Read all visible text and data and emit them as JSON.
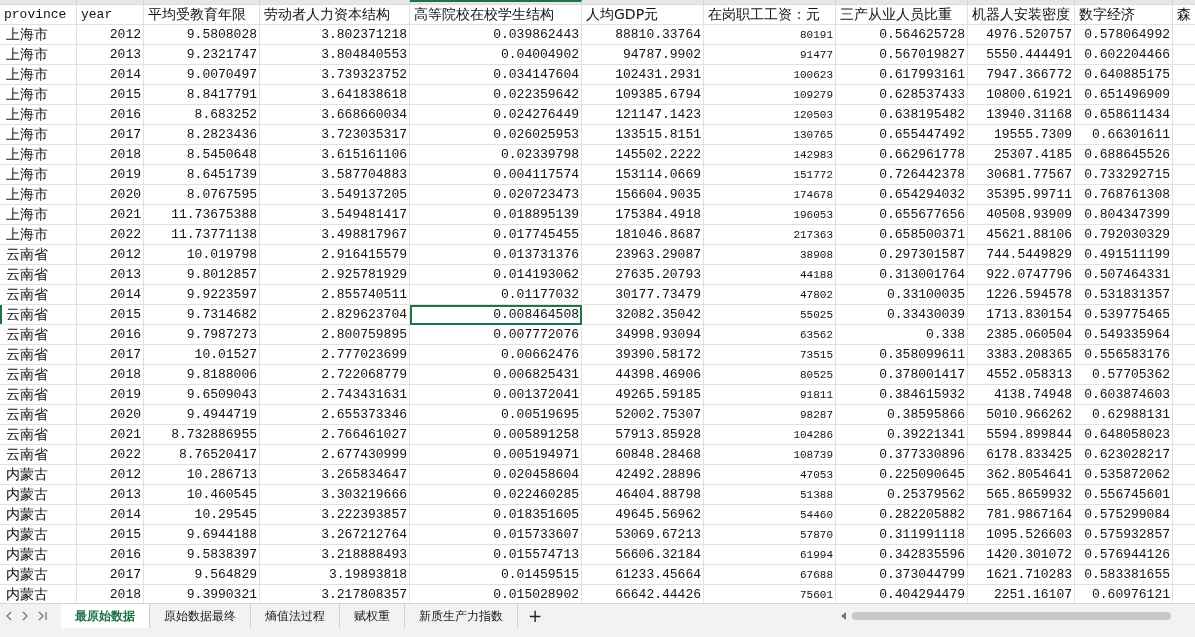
{
  "columns": [
    {
      "label": "province",
      "kind": "text",
      "selected": false
    },
    {
      "label": "year",
      "kind": "number",
      "selected": false
    },
    {
      "label": "平均受教育年限",
      "kind": "number",
      "selected": false
    },
    {
      "label": "劳动者人力资本结构",
      "kind": "number",
      "selected": false
    },
    {
      "label": "高等院校在校学生结构",
      "kind": "number",
      "selected": true
    },
    {
      "label": "人均GDP元",
      "kind": "number",
      "selected": false
    },
    {
      "label": "在岗职工工资：元",
      "kind": "small",
      "selected": false
    },
    {
      "label": "三产从业人员比重",
      "kind": "number",
      "selected": false
    },
    {
      "label": "机器人安装密度",
      "kind": "number",
      "selected": false
    },
    {
      "label": "数字经济",
      "kind": "number",
      "selected": false
    },
    {
      "label": "森",
      "kind": "number",
      "selected": false
    }
  ],
  "rows": [
    {
      "selected": false,
      "cells": [
        "上海市",
        "2012",
        "9.5808028",
        "3.802371218",
        "0.039862443",
        "88810.33764",
        "80191",
        "0.564625728",
        "4976.520757",
        "0.578064992"
      ]
    },
    {
      "selected": false,
      "cells": [
        "上海市",
        "2013",
        "9.2321747",
        "3.804840553",
        "0.04004902",
        "94787.9902",
        "91477",
        "0.567019827",
        "5550.444491",
        "0.602204466"
      ]
    },
    {
      "selected": false,
      "cells": [
        "上海市",
        "2014",
        "9.0070497",
        "3.739323752",
        "0.034147604",
        "102431.2931",
        "100623",
        "0.617993161",
        "7947.366772",
        "0.640885175"
      ]
    },
    {
      "selected": false,
      "cells": [
        "上海市",
        "2015",
        "8.8417791",
        "3.641838618",
        "0.022359642",
        "109385.6794",
        "109279",
        "0.628537433",
        "10800.61921",
        "0.651496909"
      ]
    },
    {
      "selected": false,
      "cells": [
        "上海市",
        "2016",
        "8.683252",
        "3.668660034",
        "0.024276449",
        "121147.1423",
        "120503",
        "0.638195482",
        "13940.31168",
        "0.658611434"
      ]
    },
    {
      "selected": false,
      "cells": [
        "上海市",
        "2017",
        "8.2823436",
        "3.723035317",
        "0.026025953",
        "133515.8151",
        "130765",
        "0.655447492",
        "19555.7309",
        "0.66301611"
      ]
    },
    {
      "selected": false,
      "cells": [
        "上海市",
        "2018",
        "8.5450648",
        "3.615161106",
        "0.02339798",
        "145502.2222",
        "142983",
        "0.662961778",
        "25307.4185",
        "0.688645526"
      ]
    },
    {
      "selected": false,
      "cells": [
        "上海市",
        "2019",
        "8.6451739",
        "3.587704883",
        "0.004117574",
        "153114.0669",
        "151772",
        "0.726442378",
        "30681.77567",
        "0.733292715"
      ]
    },
    {
      "selected": false,
      "cells": [
        "上海市",
        "2020",
        "8.0767595",
        "3.549137205",
        "0.020723473",
        "156604.9035",
        "174678",
        "0.654294032",
        "35395.99711",
        "0.768761308"
      ]
    },
    {
      "selected": false,
      "cells": [
        "上海市",
        "2021",
        "11.73675388",
        "3.549481417",
        "0.018895139",
        "175384.4918",
        "196053",
        "0.655677656",
        "40508.93909",
        "0.804347399"
      ]
    },
    {
      "selected": false,
      "cells": [
        "上海市",
        "2022",
        "11.73771138",
        "3.498817967",
        "0.017745455",
        "181046.8687",
        "217363",
        "0.658500371",
        "45621.88106",
        "0.792030329"
      ]
    },
    {
      "selected": false,
      "cells": [
        "云南省",
        "2012",
        "10.019798",
        "2.916415579",
        "0.013731376",
        "23963.29087",
        "38908",
        "0.297301587",
        "744.5449829",
        "0.491511199"
      ]
    },
    {
      "selected": false,
      "cells": [
        "云南省",
        "2013",
        "9.8012857",
        "2.925781929",
        "0.014193062",
        "27635.20793",
        "44188",
        "0.313001764",
        "922.0747796",
        "0.507464331"
      ]
    },
    {
      "selected": false,
      "cells": [
        "云南省",
        "2014",
        "9.9223597",
        "2.855740511",
        "0.01177032",
        "30177.73479",
        "47802",
        "0.33100035",
        "1226.594578",
        "0.531831357"
      ]
    },
    {
      "selected": true,
      "cells": [
        "云南省",
        "2015",
        "9.7314682",
        "2.829623704",
        "0.008464508",
        "32082.35042",
        "55025",
        "0.33430039",
        "1713.830154",
        "0.539775465"
      ]
    },
    {
      "selected": false,
      "cells": [
        "云南省",
        "2016",
        "9.7987273",
        "2.800759895",
        "0.007772076",
        "34998.93094",
        "63562",
        "0.338",
        "2385.060504",
        "0.549335964"
      ]
    },
    {
      "selected": false,
      "cells": [
        "云南省",
        "2017",
        "10.01527",
        "2.777023699",
        "0.00662476",
        "39390.58172",
        "73515",
        "0.358099611",
        "3383.208365",
        "0.556583176"
      ]
    },
    {
      "selected": false,
      "cells": [
        "云南省",
        "2018",
        "9.8188006",
        "2.722068779",
        "0.006825431",
        "44398.46906",
        "80525",
        "0.378001417",
        "4552.058313",
        "0.57705362"
      ]
    },
    {
      "selected": false,
      "cells": [
        "云南省",
        "2019",
        "9.6509043",
        "2.743431631",
        "0.001372041",
        "49265.59185",
        "91811",
        "0.384615932",
        "4138.74948",
        "0.603874603"
      ]
    },
    {
      "selected": false,
      "cells": [
        "云南省",
        "2020",
        "9.4944719",
        "2.655373346",
        "0.00519695",
        "52002.75307",
        "98287",
        "0.38595866",
        "5010.966262",
        "0.62988131"
      ]
    },
    {
      "selected": false,
      "cells": [
        "云南省",
        "2021",
        "8.732886955",
        "2.766461027",
        "0.005891258",
        "57913.85928",
        "104286",
        "0.39221341",
        "5594.899844",
        "0.648058023"
      ]
    },
    {
      "selected": false,
      "cells": [
        "云南省",
        "2022",
        "8.76520417",
        "2.677430999",
        "0.005194971",
        "60848.28468",
        "108739",
        "0.377330896",
        "6178.833425",
        "0.623028217"
      ]
    },
    {
      "selected": false,
      "cells": [
        "内蒙古",
        "2012",
        "10.286713",
        "3.265834647",
        "0.020458604",
        "42492.28896",
        "47053",
        "0.225090645",
        "362.8054641",
        "0.535872062"
      ]
    },
    {
      "selected": false,
      "cells": [
        "内蒙古",
        "2013",
        "10.460545",
        "3.303219666",
        "0.022460285",
        "46404.88798",
        "51388",
        "0.25379562",
        "565.8659932",
        "0.556745601"
      ]
    },
    {
      "selected": false,
      "cells": [
        "内蒙古",
        "2014",
        "10.29545",
        "3.222393857",
        "0.018351605",
        "49645.56962",
        "54460",
        "0.282205882",
        "781.9867164",
        "0.575299084"
      ]
    },
    {
      "selected": false,
      "cells": [
        "内蒙古",
        "2015",
        "9.6944188",
        "3.267212764",
        "0.015733607",
        "53069.67213",
        "57870",
        "0.311991118",
        "1095.526603",
        "0.575932857"
      ]
    },
    {
      "selected": false,
      "cells": [
        "内蒙古",
        "2016",
        "9.5838397",
        "3.218888493",
        "0.015574713",
        "56606.32184",
        "61994",
        "0.342835596",
        "1420.301072",
        "0.576944126"
      ]
    },
    {
      "selected": false,
      "cells": [
        "内蒙古",
        "2017",
        "9.564829",
        "3.19893818",
        "0.01459515",
        "61233.45664",
        "67688",
        "0.373044799",
        "1621.710283",
        "0.583381655"
      ]
    },
    {
      "selected": false,
      "cells": [
        "内蒙古",
        "2018",
        "9.3990321",
        "3.217808357",
        "0.015028902",
        "66642.44426",
        "75601",
        "0.404294479",
        "2251.16107",
        "0.60976121"
      ]
    }
  ],
  "sheet_tabs": [
    {
      "label": "最原始数据",
      "selected": true
    },
    {
      "label": "原始数据最终",
      "selected": false
    },
    {
      "label": "熵值法过程",
      "selected": false
    },
    {
      "label": "赋权重",
      "selected": false
    },
    {
      "label": "新质生产力指数",
      "selected": false
    }
  ],
  "add_sheet": "+"
}
